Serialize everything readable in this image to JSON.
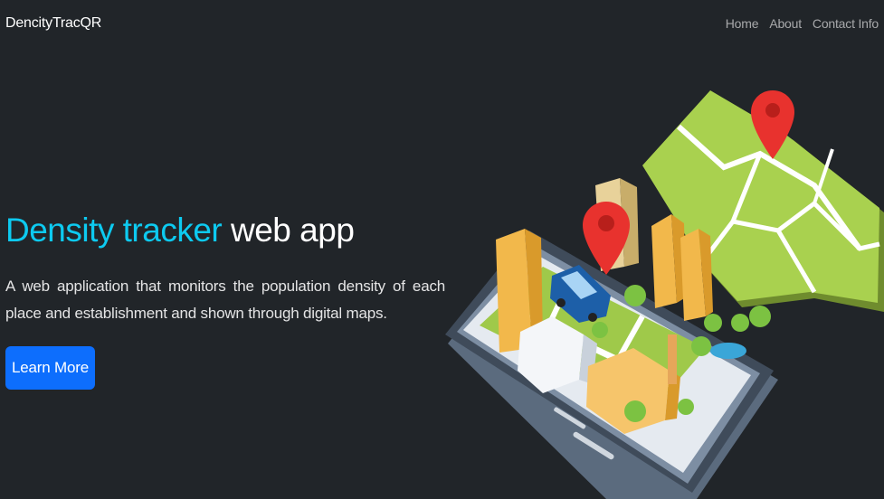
{
  "navbar": {
    "brand": "DencityTracQR",
    "links": [
      {
        "label": "Home"
      },
      {
        "label": "About"
      },
      {
        "label": "Contact Info"
      }
    ]
  },
  "hero": {
    "title_accent": "Density tracker",
    "title_rest": " web app",
    "description": "A web application that monitors the population density of each place and establishment and shown through digital maps.",
    "cta_label": "Learn More"
  },
  "colors": {
    "background": "#212529",
    "accent": "#0dcaf0",
    "button": "#0d6efd",
    "map_green": "#a9d14f",
    "pin_red": "#e8322e"
  },
  "illustration": {
    "icons": [
      "phone-map-illustration",
      "location-pin-icon",
      "car-icon",
      "building-icon",
      "tree-icon"
    ]
  }
}
